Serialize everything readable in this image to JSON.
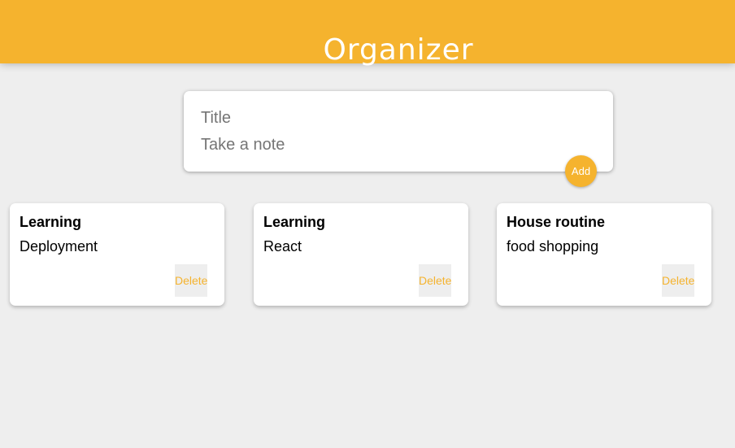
{
  "header": {
    "title": "Organizer"
  },
  "composer": {
    "title_placeholder": "Title",
    "title_value": "",
    "content_placeholder": "Take a note",
    "content_value": "",
    "add_label": "Add"
  },
  "notes": [
    {
      "title": "Learning",
      "content": "Deployment",
      "delete_label": "Delete"
    },
    {
      "title": "Learning",
      "content": "React",
      "delete_label": "Delete"
    },
    {
      "title": "House routine",
      "content": "food shopping",
      "delete_label": "Delete"
    }
  ],
  "colors": {
    "accent": "#f5b32e",
    "background": "#eeeeee",
    "card": "#ffffff"
  }
}
